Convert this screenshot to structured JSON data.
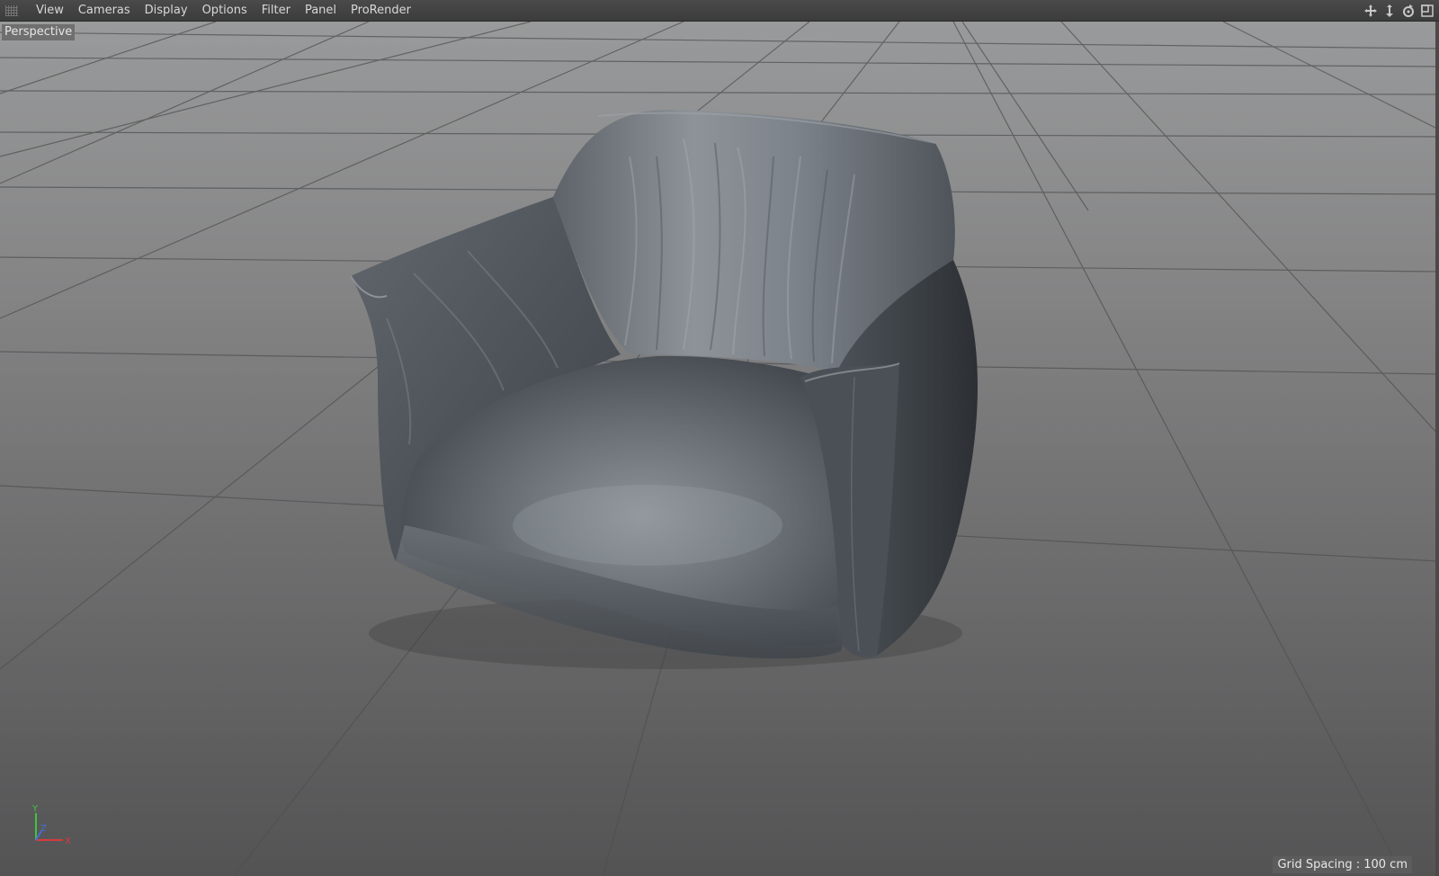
{
  "menubar": {
    "items": [
      "View",
      "Cameras",
      "Display",
      "Options",
      "Filter",
      "Panel",
      "ProRender"
    ],
    "icons": [
      "move-view-icon",
      "dolly-view-icon",
      "rotate-view-icon",
      "maximize-view-icon"
    ]
  },
  "viewport": {
    "camera_label": "Perspective",
    "grid_spacing": "Grid Spacing : 100 cm",
    "axis_labels": {
      "y": "Y",
      "z": "Z",
      "x": "X"
    },
    "axis_colors": {
      "x": "#d83a3a",
      "y": "#3ec43e",
      "z": "#4a6ad8"
    },
    "object": "armchair"
  }
}
